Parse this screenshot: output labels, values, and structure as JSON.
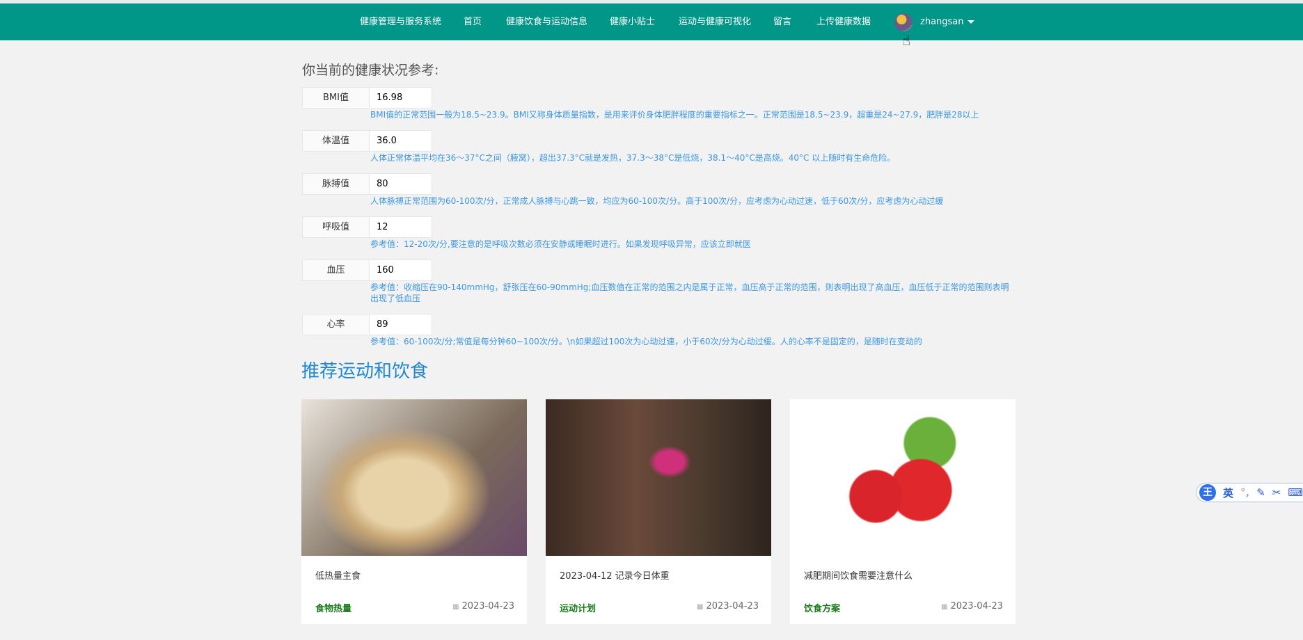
{
  "nav": {
    "brand": "健康管理与服务系统",
    "items": [
      "首页",
      "健康饮食与运动信息",
      "健康小贴士",
      "运动与健康可视化",
      "留言",
      "上传健康数据"
    ],
    "username": "zhangsan"
  },
  "health": {
    "title": "你当前的健康状况参考:",
    "rows": [
      {
        "label": "BMI值",
        "value": "16.98",
        "desc": "BMI值的正常范围一般为18.5~23.9。BMI又称身体质量指数，是用来评价身体肥胖程度的重要指标之一。正常范围是18.5~23.9，超重是24~27.9，肥胖是28以上"
      },
      {
        "label": "体温值",
        "value": "36.0",
        "desc": "人体正常体温平均在36～37°C之间（腋窝），超出37.3°C就是发热，37.3～38°C是低烧，38.1～40°C是高烧。40°C 以上随时有生命危险。"
      },
      {
        "label": "脉搏值",
        "value": "80",
        "desc": "人体脉搏正常范围为60-100次/分，正常成人脉搏与心跳一致，均应为60-100次/分。高于100次/分，应考虑为心动过速，低于60次/分，应考虑为心动过缓"
      },
      {
        "label": "呼吸值",
        "value": "12",
        "desc": "参考值：12-20次/分,要注意的是呼吸次数必须在安静或睡眠时进行。如果发现呼吸异常，应该立即就医"
      },
      {
        "label": "血压",
        "value": "160",
        "desc": "参考值：收缩压在90-140mmHg，舒张压在60-90mmHg;血压数值在正常的范围之内是属于正常，血压高于正常的范围，则表明出现了高血压，血压低于正常的范围则表明出现了低血压"
      },
      {
        "label": "心率",
        "value": "89",
        "desc": "参考值：60-100次/分;常值是每分钟60~100次/分。\\n如果超过100次为心动过速，小于60次/分为心动过缓。人的心率不是固定的，是随时在变动的"
      }
    ]
  },
  "recommend": {
    "title": "推荐运动和饮食",
    "cards": [
      {
        "title": "低热量主食",
        "category": "食物热量",
        "date": "2023-04-23"
      },
      {
        "title": "2023-04-12 记录今日体重",
        "category": "运动计划",
        "date": "2023-04-23"
      },
      {
        "title": "减肥期间饮食需要注意什么",
        "category": "饮食方案",
        "date": "2023-04-23"
      }
    ]
  },
  "ime": {
    "logo": "王",
    "lang": "英"
  }
}
